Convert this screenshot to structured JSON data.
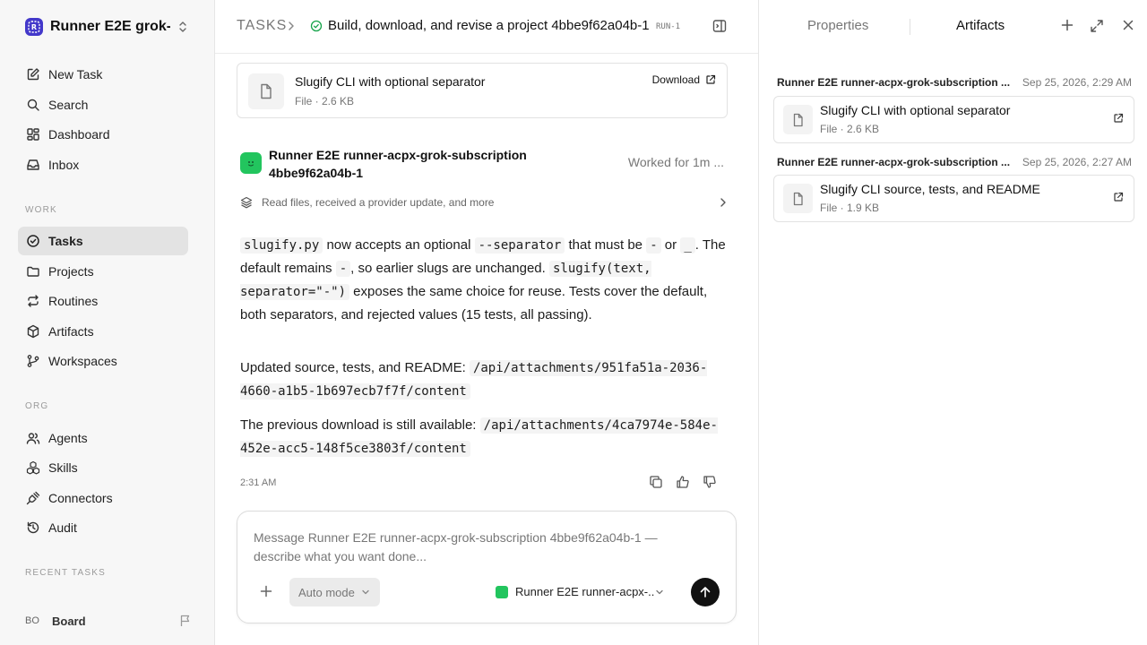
{
  "workspace": {
    "name": "Runner E2E grok-..."
  },
  "sidebar": {
    "top_items": [
      {
        "label": "New Task",
        "icon": "edit-icon"
      },
      {
        "label": "Search",
        "icon": "search-icon"
      },
      {
        "label": "Dashboard",
        "icon": "dashboard-icon"
      },
      {
        "label": "Inbox",
        "icon": "inbox-icon"
      }
    ],
    "work_label": "WORK",
    "work_items": [
      {
        "label": "Tasks",
        "icon": "check-circle-icon",
        "active": true
      },
      {
        "label": "Projects",
        "icon": "folder-icon"
      },
      {
        "label": "Routines",
        "icon": "repeat-icon"
      },
      {
        "label": "Artifacts",
        "icon": "package-icon"
      },
      {
        "label": "Workspaces",
        "icon": "git-branch-icon"
      }
    ],
    "org_label": "ORG",
    "org_items": [
      {
        "label": "Agents",
        "icon": "users-icon"
      },
      {
        "label": "Skills",
        "icon": "boxes-icon"
      },
      {
        "label": "Connectors",
        "icon": "plug-icon"
      },
      {
        "label": "Audit",
        "icon": "history-icon"
      }
    ],
    "recent_label": "RECENT TASKS",
    "user": {
      "initials": "BO",
      "name": "Board"
    }
  },
  "header": {
    "root": "TASKS",
    "title": "Build, download, and revise a project 4bbe9f62a04b-1",
    "run": "RUN-1"
  },
  "file_card": {
    "title": "Slugify CLI with optional separator",
    "meta": "File · 2.6 KB",
    "download_label": "Download"
  },
  "message": {
    "agent_name": "Runner E2E runner-acpx-grok-subscription 4bbe9f62a04b-1",
    "worked": "Worked for 1m ...",
    "activity": "Read files, received a provider update, and more",
    "p1": {
      "code1": "slugify.py",
      "t1": " now accepts an optional ",
      "code2": "--separator",
      "t2": " that must be ",
      "code3": "-",
      "t3": " or ",
      "code4": "_",
      "t4": ". The default remains ",
      "code5": "-",
      "t5": ", so earlier slugs are unchanged. ",
      "code6": "slugify(text, separator=\"-\")",
      "t6": " exposes the same choice for reuse. Tests cover the default, both separators, and rejected values (15 tests, all passing)."
    },
    "p2": {
      "text": "Updated source, tests, and README: ",
      "code": "/api/attachments/951fa51a-2036-4660-a1b5-1b697ecb7f7f/content"
    },
    "p3": {
      "text": "The previous download is still available: ",
      "code": "/api/attachments/4ca7974e-584e-452e-acc5-148f5ce3803f/content"
    },
    "time": "2:31 AM"
  },
  "composer": {
    "placeholder": "Message Runner E2E runner-acpx-grok-subscription 4bbe9f62a04b-1 — describe what you want done...",
    "mode": "Auto mode",
    "agent": "Runner E2E runner-acpx-..."
  },
  "right_panel": {
    "tab_properties": "Properties",
    "tab_artifacts": "Artifacts",
    "artifacts": [
      {
        "who": "Runner E2E runner-acpx-grok-subscription ...",
        "when": "Sep 25, 2026, 2:29 AM",
        "title": "Slugify CLI with optional separator",
        "meta": "File · 2.6 KB"
      },
      {
        "who": "Runner E2E runner-acpx-grok-subscription ...",
        "when": "Sep 25, 2026, 2:27 AM",
        "title": "Slugify CLI source, tests, and README",
        "meta": "File · 1.9 KB"
      }
    ]
  },
  "colors": {
    "accent": "#4338ca",
    "agent": "#22c55e",
    "active_nav": "#e3e3e3"
  }
}
